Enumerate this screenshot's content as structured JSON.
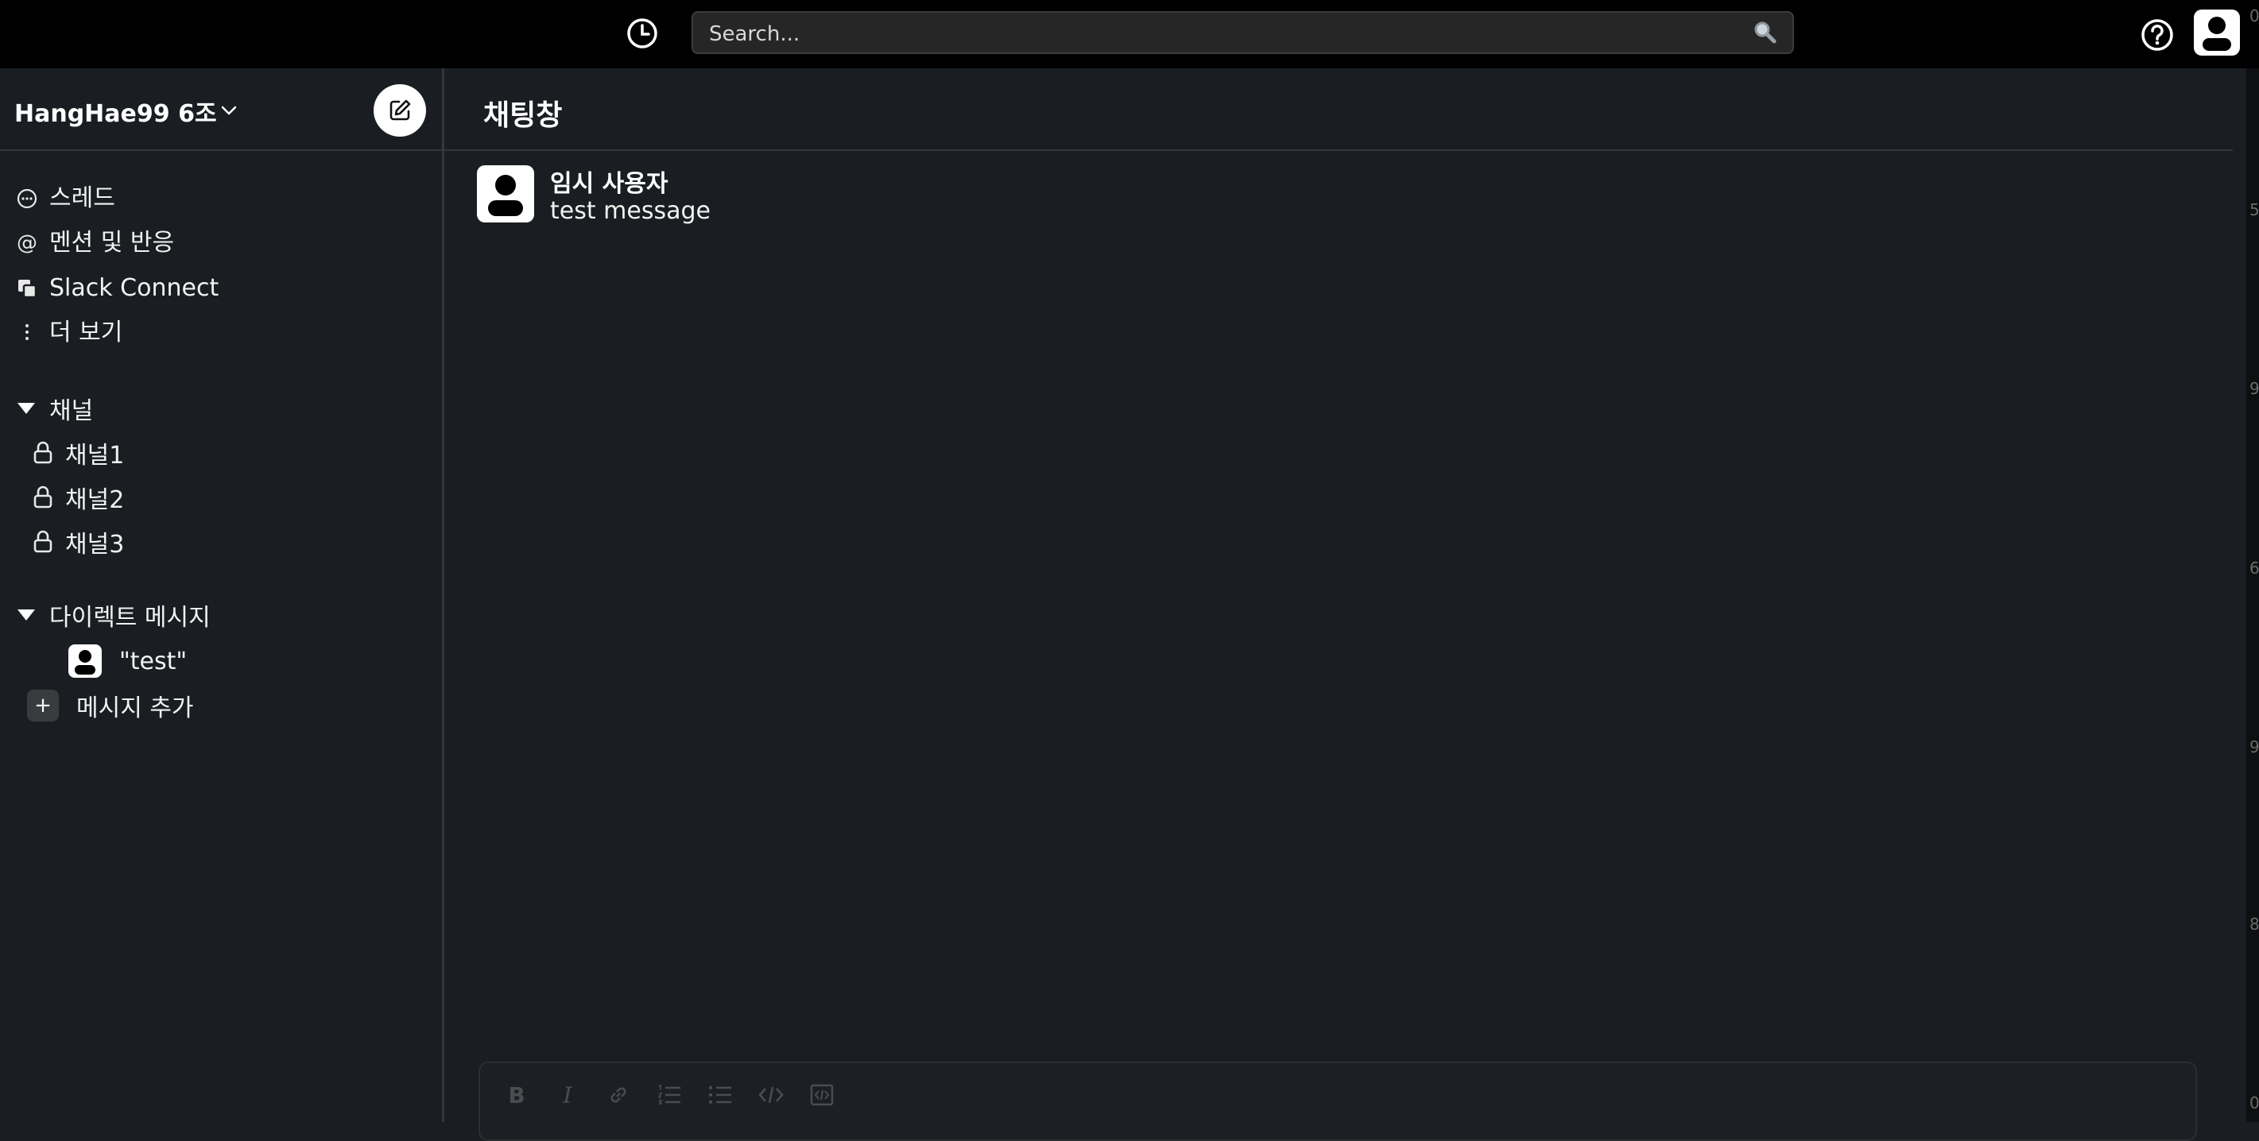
{
  "topbar": {
    "search_placeholder": "Search...",
    "icons": [
      "clock-icon",
      "search-icon",
      "help-icon",
      "user-avatar"
    ]
  },
  "sidebar": {
    "workspace_name": "HangHae99 6조",
    "nav": [
      {
        "label": "스레드",
        "icon": "thread-icon"
      },
      {
        "label": "멘션 및 반응",
        "icon": "at-icon"
      },
      {
        "label": "Slack Connect",
        "icon": "connect-icon"
      },
      {
        "label": "더 보기",
        "icon": "more-icon"
      }
    ],
    "channels_header": "채널",
    "channels": [
      "채널1",
      "채널2",
      "채널3"
    ],
    "dm_header": "다이렉트 메시지",
    "dms": [
      "\"test\""
    ],
    "add_message": "메시지 추가"
  },
  "main": {
    "title": "채팅창",
    "messages": [
      {
        "author": "임시 사용자",
        "text": "test message"
      }
    ]
  },
  "composer": {
    "format_buttons": [
      "bold-icon",
      "italic-icon",
      "link-icon",
      "ordered-list-icon",
      "bullet-list-icon",
      "code-icon",
      "code-block-icon"
    ]
  },
  "edge_glyphs": [
    "0",
    "5",
    "9",
    "6",
    "9",
    "8",
    "0"
  ],
  "colors": {
    "background": "#1a1d21",
    "topbar": "#000000",
    "divider": "#35373b",
    "text": "#ffffff"
  }
}
